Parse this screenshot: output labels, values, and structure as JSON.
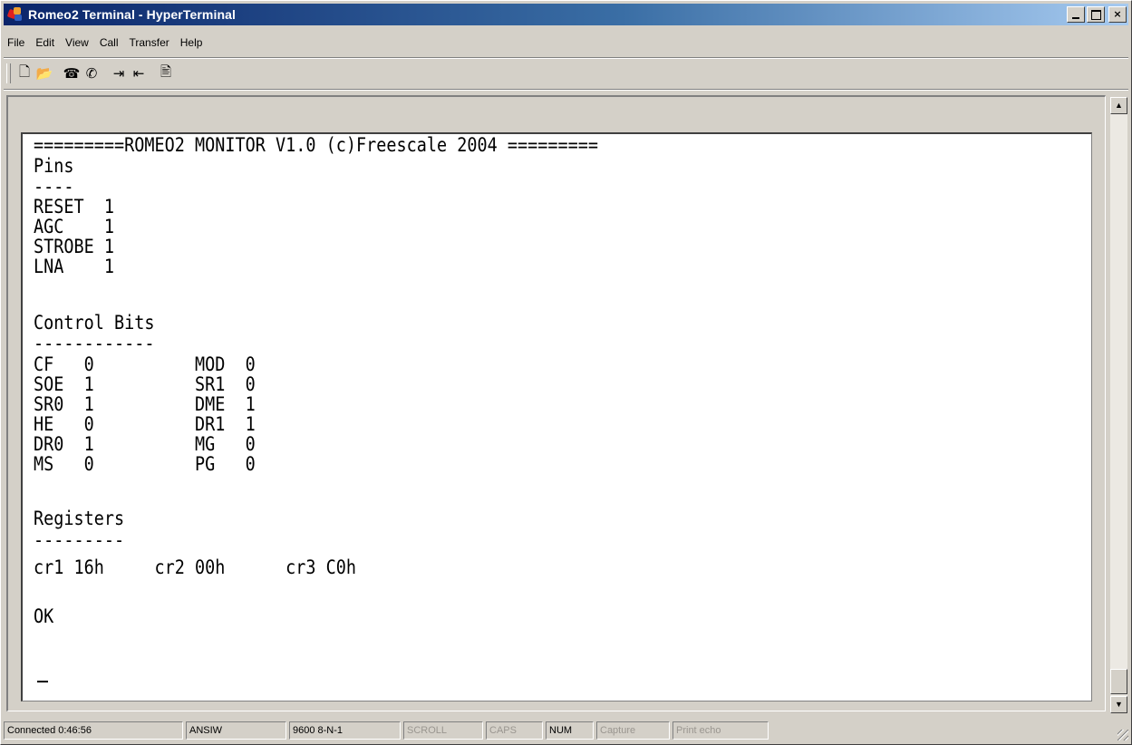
{
  "window": {
    "title": "Romeo2 Terminal - HyperTerminal",
    "close_glyph": "×"
  },
  "menu": [
    "File",
    "Edit",
    "View",
    "Call",
    "Transfer",
    "Help"
  ],
  "toolbar": {
    "icons": [
      "new-icon",
      "open-icon",
      "call-icon",
      "disconnect-icon",
      "send-icon",
      "receive-icon",
      "properties-icon"
    ],
    "glyphs": [
      "🗋",
      "📂",
      "☎",
      "✆",
      "⇥",
      "⇤",
      "🖹"
    ]
  },
  "terminal": {
    "lines": [
      "=========ROMEO2 MONITOR V1.0 (c)Freescale 2004 =========",
      "Pins",
      "----",
      "RESET  1",
      "AGC    1",
      "STROBE 1",
      "LNA    1",
      "",
      "Control Bits",
      "------------",
      "CF   0          MOD  0",
      "SOE  1          SR1  0",
      "SR0  1          DME  1",
      "HE   0          DR1  1",
      "DR0  1          MG   0",
      "MS   0          PG   0",
      "",
      "Registers",
      "---------",
      "cr1 16h     cr2 00h      cr3 C0h",
      "",
      "OK"
    ]
  },
  "scrollbar": {
    "up_glyph": "▲",
    "down_glyph": "▼"
  },
  "statusbar": {
    "connection": "Connected 0:46:56",
    "emulation": "ANSIW",
    "settings": "9600 8-N-1",
    "scroll": "SCROLL",
    "caps": "CAPS",
    "num": "NUM",
    "capture": "Capture",
    "print_echo": "Print echo"
  }
}
